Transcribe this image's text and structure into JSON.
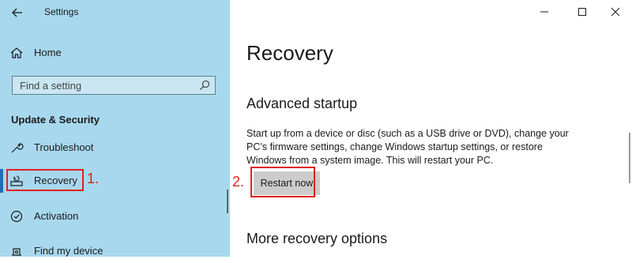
{
  "window": {
    "app_title": "Settings"
  },
  "sidebar": {
    "home_label": "Home",
    "search_placeholder": "Find a setting",
    "section_heading": "Update & Security",
    "items": [
      {
        "label": "Troubleshoot",
        "icon": "wrench-icon"
      },
      {
        "label": "Recovery",
        "icon": "recovery-icon",
        "active": true
      },
      {
        "label": "Activation",
        "icon": "activation-icon"
      },
      {
        "label": "Find my device",
        "icon": "find-device-icon"
      }
    ]
  },
  "main": {
    "page_title": "Recovery",
    "advanced_startup": {
      "heading": "Advanced startup",
      "description": "Start up from a device or disc (such as a USB drive or DVD), change your PC’s firmware settings, change Windows startup settings, or restore Windows from a system image. This will restart your PC.",
      "button_label": "Restart now"
    },
    "more_options_heading": "More recovery options"
  },
  "annotations": {
    "step1": "1.",
    "step2": "2.",
    "color": "#e02020"
  },
  "colors": {
    "sidebar_bg": "#a8d8ee",
    "accent": "#1f6fb3"
  }
}
